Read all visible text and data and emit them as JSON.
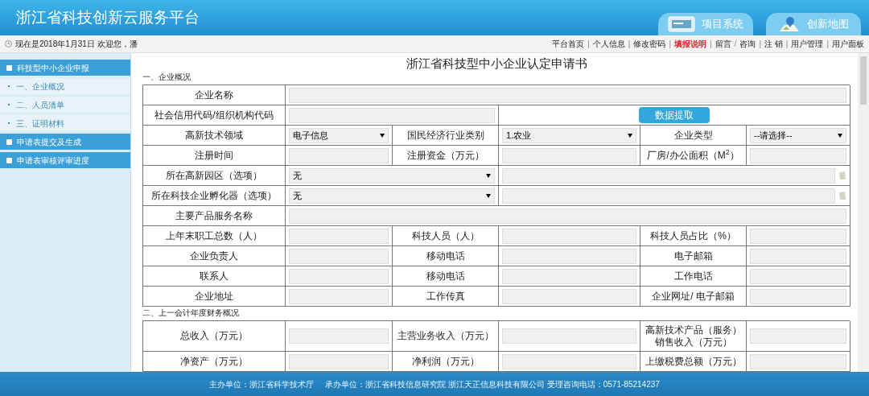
{
  "header": {
    "title": "浙江省科技创新云服务平台",
    "tabs": [
      {
        "label": "项目系统",
        "kind": "screen"
      },
      {
        "label": "创新地图",
        "kind": "map"
      }
    ]
  },
  "status_bar": {
    "welcome": "现在是2018年1月31日 欢迎您，潘",
    "links": [
      {
        "label": "平台首页",
        "highlight": false,
        "sep": "|"
      },
      {
        "label": "个人信息",
        "highlight": false,
        "sep": "|"
      },
      {
        "label": "修改密码",
        "highlight": false,
        "sep": "|"
      },
      {
        "label": "填报说明",
        "highlight": true,
        "sep": "|"
      },
      {
        "label": "留言",
        "highlight": false,
        "sep": "/"
      },
      {
        "label": "咨询",
        "highlight": false,
        "sep": "|"
      },
      {
        "label": "注 销",
        "highlight": false,
        "sep": "|"
      },
      {
        "label": "用户管理",
        "highlight": false,
        "sep": "|"
      },
      {
        "label": "用户面板",
        "highlight": false
      }
    ]
  },
  "sidebar": {
    "items": [
      {
        "label": "科技型中小企业申报",
        "children": [
          {
            "label": "一、企业概况"
          },
          {
            "label": "二、人员清单"
          },
          {
            "label": "三、证明材料"
          }
        ]
      },
      {
        "label": "申请表提交及生成"
      },
      {
        "label": "申请表审核评审进度"
      }
    ]
  },
  "form": {
    "title": "浙江省科技型中小企业认定申请书",
    "sections": [
      {
        "heading": "一、企业概况",
        "rows": [
          [
            {
              "kind": "label",
              "text": "企业名称"
            },
            {
              "kind": "longinput"
            }
          ],
          [
            {
              "kind": "label",
              "text": "社会信用代码/组织机构代码"
            },
            {
              "kind": "pairinput"
            },
            {
              "kind": "button",
              "text": "数据提取"
            }
          ],
          [
            {
              "kind": "label",
              "text": "高新技术领域"
            },
            {
              "kind": "select",
              "value": "电子信息"
            },
            {
              "kind": "label",
              "text": "国民经济行业类别"
            },
            {
              "kind": "select",
              "value": "1.农业"
            },
            {
              "kind": "label",
              "text": "企业类型"
            },
            {
              "kind": "select",
              "value": "--请选择--"
            }
          ],
          [
            {
              "kind": "label",
              "text": "注册时间"
            },
            {
              "kind": "input"
            },
            {
              "kind": "label",
              "text": "注册资金（万元）"
            },
            {
              "kind": "input"
            },
            {
              "kind": "label",
              "text": "厂房/办公面积（M$^{2}$）"
            },
            {
              "kind": "input"
            }
          ],
          [
            {
              "kind": "label",
              "text": "所在高新园区（选项）"
            },
            {
              "kind": "pairselect",
              "value": "无"
            },
            {
              "kind": "noteinput"
            }
          ],
          [
            {
              "kind": "label",
              "text": "所在科技企业孵化器（选项）"
            },
            {
              "kind": "pairselect",
              "value": "无"
            },
            {
              "kind": "noteinput"
            }
          ],
          [
            {
              "kind": "label",
              "text": "主要产品服务名称"
            },
            {
              "kind": "longinput"
            }
          ],
          [
            {
              "kind": "label",
              "text": "上年末职工总数（人）"
            },
            {
              "kind": "input"
            },
            {
              "kind": "label",
              "text": "科技人员（人）"
            },
            {
              "kind": "input"
            },
            {
              "kind": "label",
              "text": "科技人员占比（%）"
            },
            {
              "kind": "input"
            }
          ],
          [
            {
              "kind": "label",
              "text": "企业负责人"
            },
            {
              "kind": "input"
            },
            {
              "kind": "label",
              "text": "移动电话"
            },
            {
              "kind": "input"
            },
            {
              "kind": "label",
              "text": "电子邮箱"
            },
            {
              "kind": "input"
            }
          ],
          [
            {
              "kind": "label",
              "text": "联系人"
            },
            {
              "kind": "input"
            },
            {
              "kind": "label",
              "text": "移动电话"
            },
            {
              "kind": "input"
            },
            {
              "kind": "label",
              "text": "工作电话"
            },
            {
              "kind": "input"
            }
          ],
          [
            {
              "kind": "label",
              "text": "企业地址"
            },
            {
              "kind": "input"
            },
            {
              "kind": "label",
              "text": "工作传真"
            },
            {
              "kind": "input"
            },
            {
              "kind": "label",
              "text": "企业网址/ 电子邮箱"
            },
            {
              "kind": "input"
            }
          ]
        ]
      },
      {
        "heading": "二、上一会计年度财务概况",
        "rows": [
          [
            {
              "kind": "label",
              "text": "总收入（万元）"
            },
            {
              "kind": "input"
            },
            {
              "kind": "label",
              "text": "主营业务收入（万元）"
            },
            {
              "kind": "input"
            },
            {
              "kind": "label",
              "text": "高新技术产品（服务）销售收入（万元）"
            },
            {
              "kind": "input"
            }
          ],
          [
            {
              "kind": "label",
              "text": "净资产（万元）"
            },
            {
              "kind": "input"
            },
            {
              "kind": "label",
              "text": "净利润（万元）"
            },
            {
              "kind": "input"
            },
            {
              "kind": "label",
              "text": "上缴税费总额（万元）"
            },
            {
              "kind": "input"
            }
          ]
        ]
      }
    ]
  },
  "footer": {
    "texts": [
      "主办单位：浙江省科学技术厅",
      "承办单位：浙江省科技信息研究院 浙江天正信息科技有限公司 受理咨询电话：0571-85214237"
    ]
  }
}
